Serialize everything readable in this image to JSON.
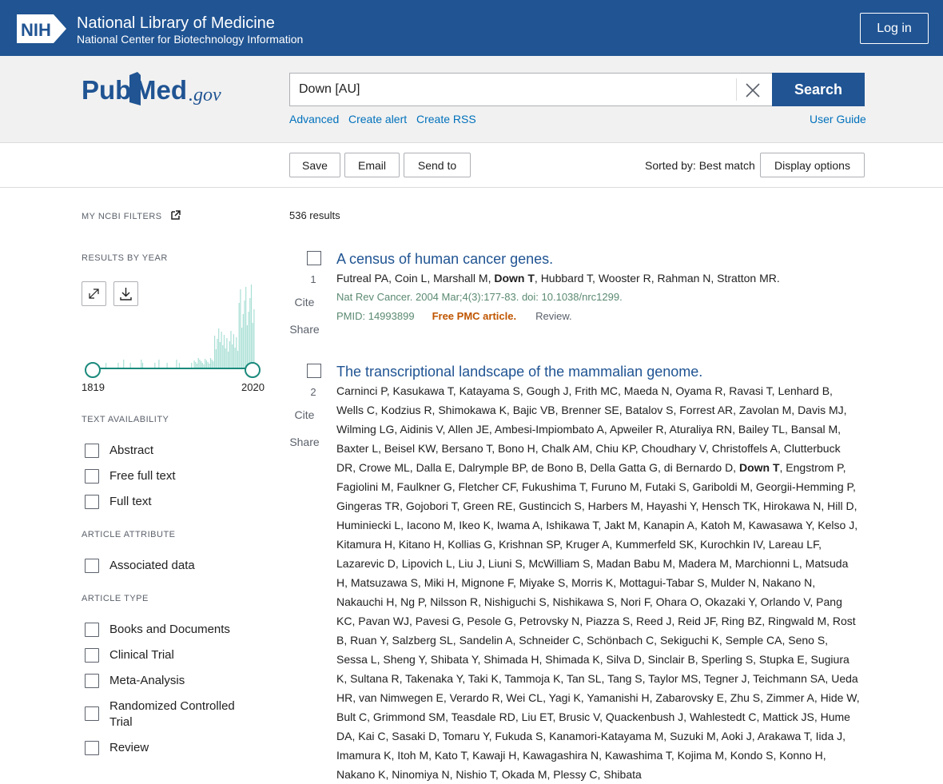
{
  "header": {
    "logo_text": "NIH",
    "title": "National Library of Medicine",
    "subtitle": "National Center for Biotechnology Information",
    "login_label": "Log in"
  },
  "search": {
    "logo_text_left": "Pub",
    "logo_text_right": "Med",
    "logo_suffix": ".gov",
    "query": "Down [AU]",
    "button_label": "Search",
    "links": [
      "Advanced",
      "Create alert",
      "Create RSS"
    ],
    "user_guide": "User Guide"
  },
  "toolbar": {
    "save": "Save",
    "email": "Email",
    "send_to": "Send to",
    "sorted_by": "Sorted by: Best match",
    "display_options": "Display options"
  },
  "sidebar": {
    "my_filters": "MY NCBI FILTERS",
    "results_by_year": "RESULTS BY YEAR",
    "year_start": "1819",
    "year_end": "2020",
    "text_availability": "TEXT AVAILABILITY",
    "text_filters": [
      "Abstract",
      "Free full text",
      "Full text"
    ],
    "article_attribute": "ARTICLE ATTRIBUTE",
    "attribute_filters": [
      "Associated data"
    ],
    "article_type": "ARTICLE TYPE",
    "type_filters": [
      "Books and Documents",
      "Clinical Trial",
      "Meta-Analysis",
      "Randomized Controlled Trial",
      "Review"
    ]
  },
  "results": {
    "count": "536 results",
    "items": [
      {
        "num": "1",
        "cite": "Cite",
        "share": "Share",
        "title": "A census of human cancer genes.",
        "authors_before": "Futreal PA, Coin L, Marshall M, ",
        "authors_bold": "Down T",
        "authors_after": ", Hubbard T, Wooster R, Rahman N, Stratton MR.",
        "citation": "Nat Rev Cancer. 2004 Mar;4(3):177-83. doi: 10.1038/nrc1299.",
        "pmid": "PMID: 14993899",
        "free": "Free PMC article.",
        "type": "Review."
      },
      {
        "num": "2",
        "cite": "Cite",
        "share": "Share",
        "title": "The transcriptional landscape of the mammalian genome.",
        "authors_before": "Carninci P, Kasukawa T, Katayama S, Gough J, Frith MC, Maeda N, Oyama R, Ravasi T, Lenhard B, Wells C, Kodzius R, Shimokawa K, Bajic VB, Brenner SE, Batalov S, Forrest AR, Zavolan M, Davis MJ, Wilming LG, Aidinis V, Allen JE, Ambesi-Impiombato A, Apweiler R, Aturaliya RN, Bailey TL, Bansal M, Baxter L, Beisel KW, Bersano T, Bono H, Chalk AM, Chiu KP, Choudhary V, Christoffels A, Clutterbuck DR, Crowe ML, Dalla E, Dalrymple BP, de Bono B, Della Gatta G, di Bernardo D, ",
        "authors_bold": "Down T",
        "authors_after": ", Engstrom P, Fagiolini M, Faulkner G, Fletcher CF, Fukushima T, Furuno M, Futaki S, Gariboldi M, Georgii-Hemming P, Gingeras TR, Gojobori T, Green RE, Gustincich S, Harbers M, Hayashi Y, Hensch TK, Hirokawa N, Hill D, Huminiecki L, Iacono M, Ikeo K, Iwama A, Ishikawa T, Jakt M, Kanapin A, Katoh M, Kawasawa Y, Kelso J, Kitamura H, Kitano H, Kollias G, Krishnan SP, Kruger A, Kummerfeld SK, Kurochkin IV, Lareau LF, Lazarevic D, Lipovich L, Liu J, Liuni S, McWilliam S, Madan Babu M, Madera M, Marchionni L, Matsuda H, Matsuzawa S, Miki H, Mignone F, Miyake S, Morris K, Mottagui-Tabar S, Mulder N, Nakano N, Nakauchi H, Ng P, Nilsson R, Nishiguchi S, Nishikawa S, Nori F, Ohara O, Okazaki Y, Orlando V, Pang KC, Pavan WJ, Pavesi G, Pesole G, Petrovsky N, Piazza S, Reed J, Reid JF, Ring BZ, Ringwald M, Rost B, Ruan Y, Salzberg SL, Sandelin A, Schneider C, Schönbach C, Sekiguchi K, Semple CA, Seno S, Sessa L, Sheng Y, Shibata Y, Shimada H, Shimada K, Silva D, Sinclair B, Sperling S, Stupka E, Sugiura K, Sultana R, Takenaka Y, Taki K, Tammoja K, Tan SL, Tang S, Taylor MS, Tegner J, Teichmann SA, Ueda HR, van Nimwegen E, Verardo R, Wei CL, Yagi K, Yamanishi H, Zabarovsky E, Zhu S, Zimmer A, Hide W, Bult C, Grimmond SM, Teasdale RD, Liu ET, Brusic V, Quackenbush J, Wahlestedt C, Mattick JS, Hume DA, Kai C, Sasaki D, Tomaru Y, Fukuda S, Kanamori-Katayama M, Suzuki M, Aoki J, Arakawa T, Iida J, Imamura K, Itoh M, Kato T, Kawaji H, Kawagashira N, Kawashima T, Kojima M, Kondo S, Konno H, Nakano K, Ninomiya N, Nishio T, Okada M, Plessy C, Shibata"
      }
    ]
  },
  "colors": {
    "brand_blue": "#205493",
    "link_blue": "#0071bc",
    "chart_teal": "#1b8a7c",
    "free_orange": "#c05600"
  }
}
